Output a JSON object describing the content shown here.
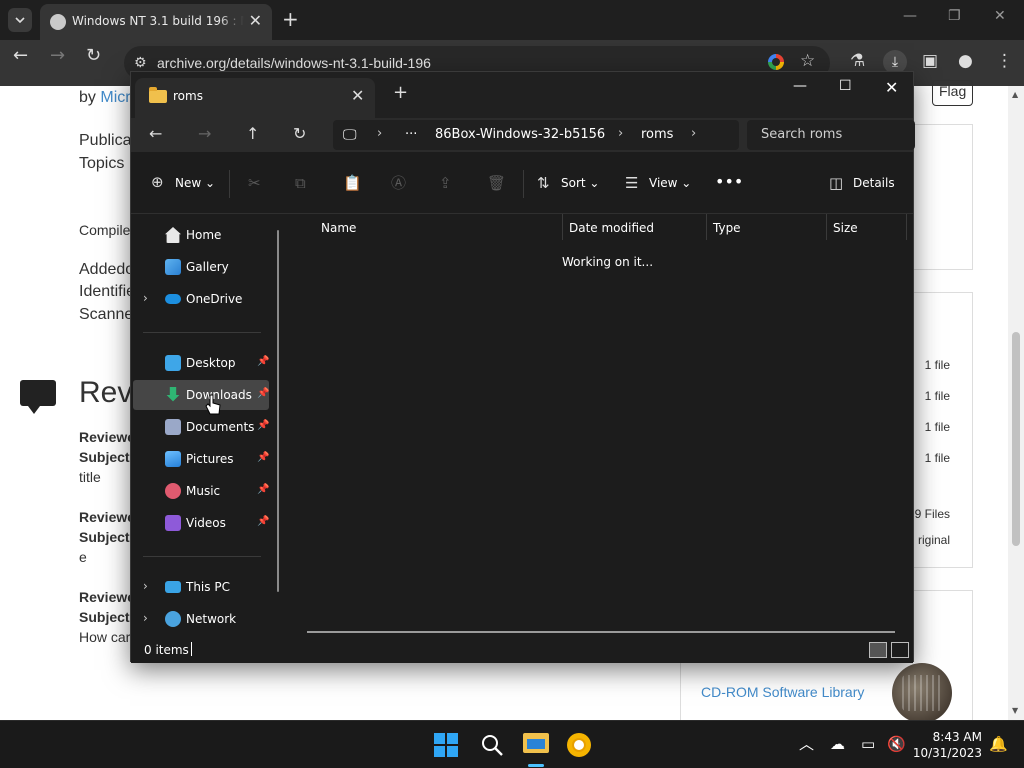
{
  "browser": {
    "tab_title": "Windows NT 3.1 build 196 : Mi",
    "url": "archive.org/details/windows-nt-3.1-build-196"
  },
  "webpage": {
    "by_prefix": "by",
    "by_link": "Micr",
    "line_publica": "Publica",
    "line_topics": "Topics",
    "line_compile": "Compile",
    "line_added": "Addedo",
    "line_identifi": "Identifie",
    "line_scanne": "Scanne",
    "reviews_heading": "Rev",
    "reviews": [
      {
        "reviewer": "Reviewe",
        "subject": "Subject",
        "body": "title"
      },
      {
        "reviewer": "Reviewe",
        "subject": "Subject",
        "body": "e"
      },
      {
        "reviewer": "Reviewe",
        "subject": "Subject",
        "body": "How car"
      }
    ],
    "flag_label": "Flag",
    "file_counts": [
      "1 file",
      "1 file",
      "1 file",
      "1 file"
    ],
    "files_total": "9 Files",
    "original_label": "riginal",
    "collection_link": "CD-ROM Software Library"
  },
  "explorer": {
    "tab_title": "roms",
    "breadcrumb": [
      "86Box-Windows-32-b5156",
      "roms"
    ],
    "search_placeholder": "Search roms",
    "commands": {
      "new": "New",
      "sort": "Sort",
      "view": "View",
      "details": "Details"
    },
    "nav_items": [
      {
        "label": "Home",
        "icon": "home-icon"
      },
      {
        "label": "Gallery",
        "icon": "gallery-icon"
      },
      {
        "label": "OneDrive",
        "icon": "cloud-icon"
      },
      {
        "label": "Desktop",
        "icon": "desktop-icon"
      },
      {
        "label": "Downloads",
        "icon": "download-icon"
      },
      {
        "label": "Documents",
        "icon": "document-icon"
      },
      {
        "label": "Pictures",
        "icon": "pictures-icon"
      },
      {
        "label": "Music",
        "icon": "music-icon"
      },
      {
        "label": "Videos",
        "icon": "videos-icon"
      },
      {
        "label": "This PC",
        "icon": "computer-icon"
      },
      {
        "label": "Network",
        "icon": "network-icon"
      }
    ],
    "columns": [
      "Name",
      "Date modified",
      "Type",
      "Size"
    ],
    "loading_text": "Working on it...",
    "status": "0 items"
  },
  "taskbar": {
    "time": "8:43 AM",
    "date": "10/31/2023"
  },
  "colors": {
    "accent": "#4cc2ff",
    "folder": "#f0c04c",
    "link": "#428bca"
  }
}
